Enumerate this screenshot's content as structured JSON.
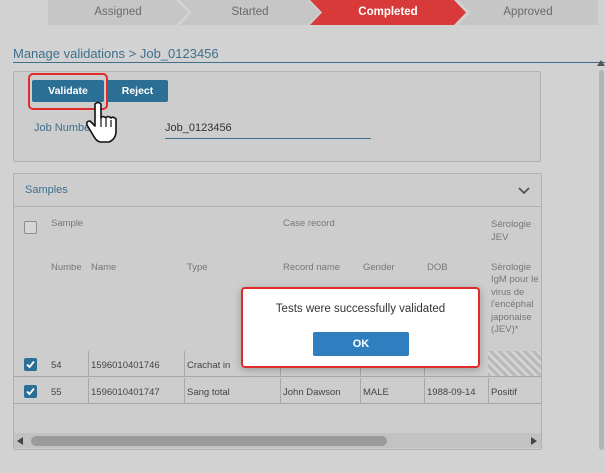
{
  "stepper": {
    "steps": [
      {
        "label": "Assigned",
        "state": "done"
      },
      {
        "label": "Started",
        "state": "done"
      },
      {
        "label": "Completed",
        "state": "active"
      },
      {
        "label": "Approved",
        "state": "pending"
      }
    ],
    "active_color": "#d83a3a"
  },
  "breadcrumb": "Manage validations > Job_0123456",
  "actions": {
    "validate_label": "Validate",
    "reject_label": "Reject"
  },
  "job": {
    "label": "Job Number",
    "value": "Job_0123456"
  },
  "samples": {
    "title": "Samples",
    "group_headers": {
      "sample": "Sample",
      "case_record": "Case record",
      "serology": "Sérologie JEV"
    },
    "columns": {
      "number": "Numbe",
      "name": "Name",
      "type": "Type",
      "record_name": "Record name",
      "gender": "Gender",
      "dob": "DOB",
      "serology_detail": "Sérologie IgM pour le virus de l'encéphal japonaise (JEV)*"
    },
    "rows": [
      {
        "number": "54",
        "name": "1596010401746",
        "type": "Crachat in",
        "record_name": "",
        "gender": "",
        "dob": "",
        "result": "",
        "checked": true
      },
      {
        "number": "55",
        "name": "1596010401747",
        "type": "Sang total",
        "record_name": "John Dawson",
        "gender": "MALE",
        "dob": "1988-09-14",
        "result": "Positif",
        "checked": true
      }
    ]
  },
  "dialog": {
    "message": "Tests were successfully validated",
    "ok_label": "OK"
  },
  "colors": {
    "primary": "#2c6f95",
    "ok_button": "#2f7fc0",
    "highlight": "#e02b2b"
  }
}
